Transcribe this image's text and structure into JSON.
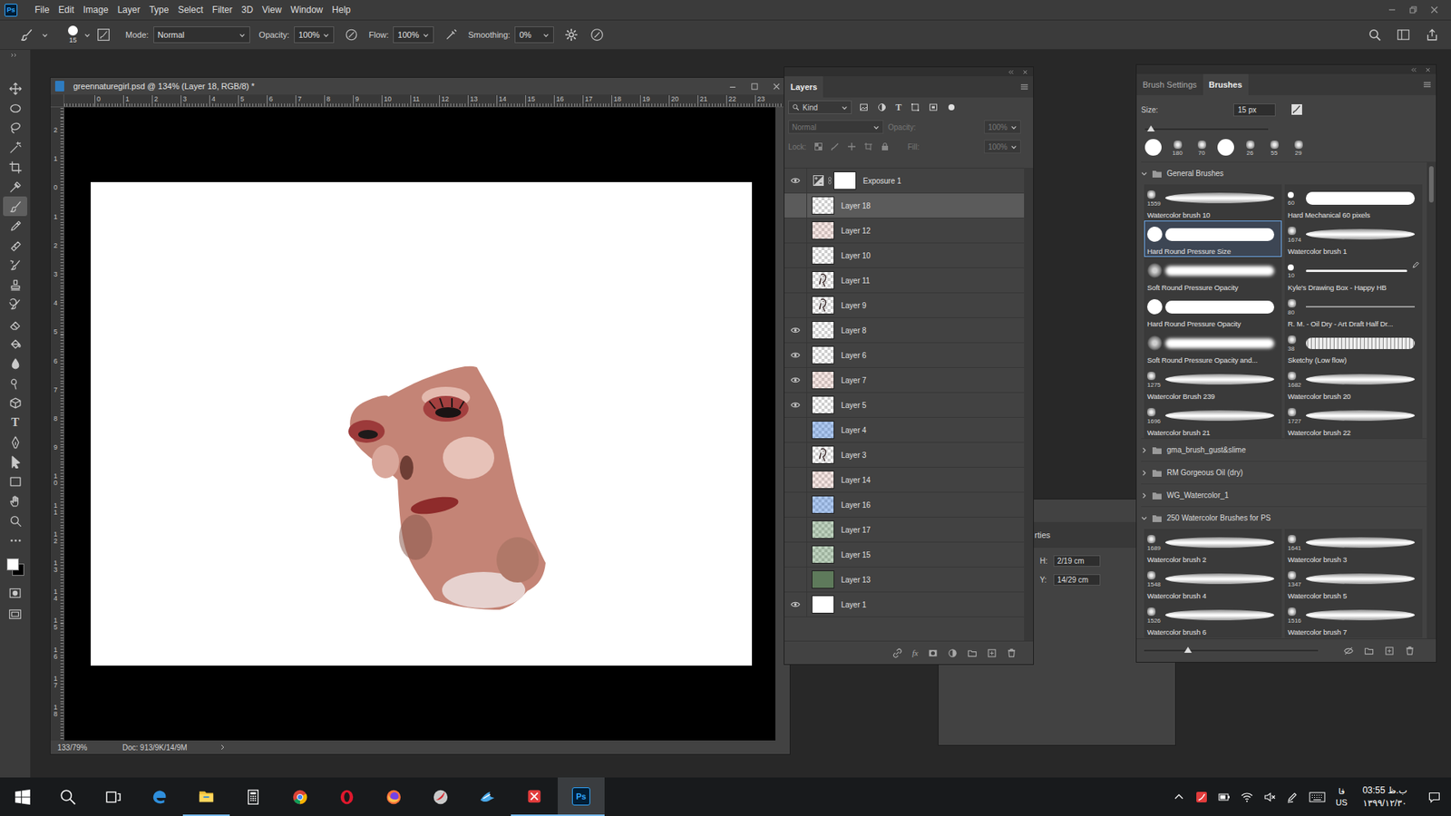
{
  "app": {
    "logo": "Ps",
    "menus": [
      "File",
      "Edit",
      "Image",
      "Layer",
      "Type",
      "Select",
      "Filter",
      "3D",
      "View",
      "Window",
      "Help"
    ]
  },
  "options_bar": {
    "brush_size": "15",
    "mode_label": "Mode:",
    "mode": "Normal",
    "opacity_label": "Opacity:",
    "opacity": "100%",
    "flow_label": "Flow:",
    "flow": "100%",
    "smoothing_label": "Smoothing:",
    "smoothing": "0%"
  },
  "tools": [
    {
      "selected": false
    },
    {
      "selected": false
    },
    {
      "selected": false
    },
    {
      "selected": false
    },
    {
      "selected": false
    },
    {
      "selected": false
    },
    {
      "selected": true
    },
    {
      "selected": false
    },
    {
      "selected": false
    },
    {
      "selected": false
    },
    {
      "selected": false
    },
    {
      "selected": false
    },
    {
      "selected": false
    },
    {
      "selected": false
    },
    {
      "selected": false
    },
    {
      "selected": false
    },
    {
      "selected": false
    },
    {
      "glyph": "T",
      "selected": false
    },
    {
      "selected": false
    },
    {
      "selected": false
    },
    {
      "selected": false
    },
    {
      "selected": false
    },
    {
      "selected": false
    },
    {
      "selected": false
    }
  ],
  "document": {
    "title": "greennaturegirl.psd @ 134% (Layer 18, RGB/8) *",
    "ruler_top": [
      "0",
      "1",
      "2",
      "3",
      "4",
      "5",
      "6",
      "7",
      "8",
      "9",
      "10",
      "11",
      "12",
      "13",
      "14",
      "15",
      "16",
      "17",
      "18",
      "19",
      "20",
      "21",
      "22",
      "23"
    ],
    "ruler_left": [
      "2",
      "1",
      "0",
      "1",
      "2",
      "3",
      "4",
      "5",
      "6",
      "7",
      "8",
      "9",
      "10",
      "11",
      "12",
      "13",
      "14",
      "15",
      "16",
      "17",
      "18"
    ],
    "zoom": "133/79%",
    "doc_info": "Doc: 913/9K/14/9M"
  },
  "layers_panel": {
    "tab": "Layers",
    "filter": "Kind",
    "type_glyph": "T",
    "blend": "Normal",
    "opacity_label": "Opacity:",
    "opacity": "100%",
    "lock_label": "Lock:",
    "fill_label": "Fill:",
    "fill": "100%",
    "controls_disabled": true,
    "fx_label": "fx",
    "layers": [
      {
        "name": "Exposure 1",
        "visible": true,
        "selected": false,
        "thumb": "adjustment"
      },
      {
        "name": "Layer 18",
        "visible": false,
        "selected": true,
        "thumb": "transparent"
      },
      {
        "name": "Layer 12",
        "visible": false,
        "selected": false,
        "thumb": "tint-red"
      },
      {
        "name": "Layer 10",
        "visible": false,
        "selected": false,
        "thumb": "transparent"
      },
      {
        "name": "Layer 11",
        "visible": false,
        "selected": false,
        "thumb": "sketch"
      },
      {
        "name": "Layer 9",
        "visible": false,
        "selected": false,
        "thumb": "sketch"
      },
      {
        "name": "Layer 8",
        "visible": true,
        "selected": false,
        "thumb": "transparent"
      },
      {
        "name": "Layer 6",
        "visible": true,
        "selected": false,
        "thumb": "transparent"
      },
      {
        "name": "Layer 7",
        "visible": true,
        "selected": false,
        "thumb": "tint-red"
      },
      {
        "name": "Layer 5",
        "visible": true,
        "selected": false,
        "thumb": "transparent"
      },
      {
        "name": "Layer 4",
        "visible": false,
        "selected": false,
        "thumb": "tint-blue"
      },
      {
        "name": "Layer 3",
        "visible": false,
        "selected": false,
        "thumb": "sketch"
      },
      {
        "name": "Layer 14",
        "visible": false,
        "selected": false,
        "thumb": "tint-red"
      },
      {
        "name": "Layer 16",
        "visible": false,
        "selected": false,
        "thumb": "tint-blue"
      },
      {
        "name": "Layer 17",
        "visible": false,
        "selected": false,
        "thumb": "tint-green"
      },
      {
        "name": "Layer 15",
        "visible": false,
        "selected": false,
        "thumb": "tint-green"
      },
      {
        "name": "Layer 13",
        "visible": false,
        "selected": false,
        "thumb": "solid-green"
      },
      {
        "name": "Layer 1",
        "visible": true,
        "selected": false,
        "thumb": "white"
      }
    ]
  },
  "properties_panel": {
    "title": "rties",
    "fields": [
      {
        "label": "H:",
        "value": "2/19 cm"
      },
      {
        "label": "Y:",
        "value": "14/29 cm"
      }
    ]
  },
  "brushes_panel": {
    "tabs": [
      {
        "label": "Brush Settings",
        "selected": false
      },
      {
        "label": "Brushes",
        "selected": true
      }
    ],
    "size_label": "Size:",
    "size_value": "15 px",
    "size_level": 0.05,
    "preview_level": 0.25,
    "recent": [
      {
        "tip": "disk"
      },
      {
        "tip": "texture",
        "size": "180"
      },
      {
        "tip": "texture",
        "size": "70"
      },
      {
        "tip": "disk"
      },
      {
        "tip": "texture",
        "size": "26"
      },
      {
        "tip": "texture",
        "size": "55"
      },
      {
        "tip": "texture",
        "size": "29"
      }
    ],
    "groups": [
      {
        "name": "General Brushes",
        "expanded": true,
        "items": [
          {
            "name": "Watercolor brush 10",
            "size": "1559",
            "tip": "texture",
            "kind": "watercolor",
            "selected": false
          },
          {
            "name": "Hard Mechanical 60 pixels",
            "size": "60",
            "tip": "dot",
            "kind": "hard",
            "selected": false
          },
          {
            "name": "Hard Round Pressure Size",
            "tip": "disk",
            "kind": "hard",
            "selected": true
          },
          {
            "name": "Watercolor brush 1",
            "size": "1674",
            "tip": "texture",
            "kind": "watercolor",
            "selected": false
          },
          {
            "name": "Soft Round Pressure Opacity",
            "tip": "soft-disk",
            "kind": "soft",
            "selected": false
          },
          {
            "name": "Kyle's Drawing Box - Happy HB",
            "size": "10",
            "tip": "dot",
            "kind": "pencil",
            "selected": false
          },
          {
            "name": "Hard Round Pressure Opacity",
            "tip": "disk",
            "kind": "hard",
            "selected": false
          },
          {
            "name": "R. M. - Oil Dry - Art Draft Half Dr...",
            "size": "80",
            "tip": "texture",
            "kind": "oil",
            "selected": false
          },
          {
            "name": "Soft Round Pressure Opacity and...",
            "tip": "soft-disk",
            "kind": "soft",
            "selected": false
          },
          {
            "name": "Sketchy (Low flow)",
            "size": "38",
            "tip": "texture",
            "kind": "sketchy",
            "selected": false
          },
          {
            "name": "Watercolor Brush 239",
            "size": "1275",
            "tip": "texture",
            "kind": "watercolor",
            "selected": false
          },
          {
            "name": "Watercolor brush 20",
            "size": "1682",
            "tip": "texture",
            "kind": "watercolor",
            "selected": false
          },
          {
            "name": "Watercolor brush 21",
            "size": "1696",
            "tip": "texture",
            "kind": "watercolor",
            "selected": false
          },
          {
            "name": "Watercolor brush 22",
            "size": "1727",
            "tip": "texture",
            "kind": "watercolor",
            "selected": false
          }
        ]
      },
      {
        "name": "gma_brush_gust&slime",
        "expanded": false,
        "items": []
      },
      {
        "name": "RM Gorgeous Oil (dry)",
        "expanded": false,
        "items": []
      },
      {
        "name": "WG_Watercolor_1",
        "expanded": false,
        "items": []
      },
      {
        "name": "250 Watercolor Brushes for PS",
        "expanded": true,
        "items": [
          {
            "name": "Watercolor brush 2",
            "size": "1689",
            "tip": "texture",
            "kind": "watercolor",
            "selected": false
          },
          {
            "name": "Watercolor brush 3",
            "size": "1641",
            "tip": "texture",
            "kind": "watercolor",
            "selected": false
          },
          {
            "name": "Watercolor brush 4",
            "size": "1548",
            "tip": "texture",
            "kind": "watercolor",
            "selected": false
          },
          {
            "name": "Watercolor brush 5",
            "size": "1347",
            "tip": "texture",
            "kind": "watercolor",
            "selected": false
          },
          {
            "name": "Watercolor brush 6",
            "size": "1526",
            "tip": "texture",
            "kind": "watercolor",
            "selected": false
          },
          {
            "name": "Watercolor brush 7",
            "size": "1516",
            "tip": "texture",
            "kind": "watercolor",
            "selected": false
          }
        ]
      }
    ]
  },
  "taskbar": {
    "apps": [
      {
        "running": false,
        "active": false
      },
      {
        "running": true,
        "active": false
      },
      {
        "running": false,
        "active": false
      },
      {
        "running": false,
        "active": false
      },
      {
        "running": false,
        "active": false
      },
      {
        "running": false,
        "active": false
      },
      {
        "running": false,
        "active": false
      },
      {
        "running": false,
        "active": false
      },
      {
        "running": true,
        "active": false
      },
      {
        "label": "Ps",
        "running": true,
        "active": true
      }
    ],
    "language": "فا",
    "layout": "US",
    "time": "03:55 ب.ظ",
    "date": "۱۳۹۹/۱۲/۳۰"
  }
}
